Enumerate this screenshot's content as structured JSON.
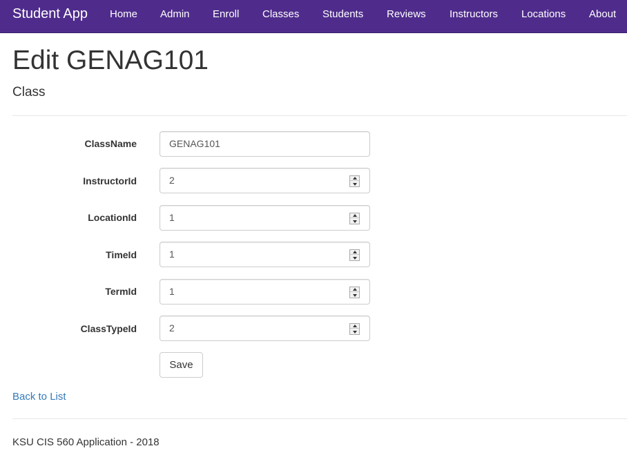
{
  "navbar": {
    "brand": "Student App",
    "links": [
      "Home",
      "Admin",
      "Enroll",
      "Classes",
      "Students",
      "Reviews",
      "Instructors",
      "Locations",
      "About"
    ]
  },
  "page": {
    "title": "Edit GENAG101",
    "subtitle": "Class"
  },
  "form": {
    "fields": [
      {
        "label": "ClassName",
        "value": "GENAG101",
        "type": "text"
      },
      {
        "label": "InstructorId",
        "value": "2",
        "type": "number"
      },
      {
        "label": "LocationId",
        "value": "1",
        "type": "number"
      },
      {
        "label": "TimeId",
        "value": "1",
        "type": "number"
      },
      {
        "label": "TermId",
        "value": "1",
        "type": "number"
      },
      {
        "label": "ClassTypeId",
        "value": "2",
        "type": "number"
      }
    ],
    "save_label": "Save"
  },
  "back_link": "Back to List",
  "footer": "KSU CIS 560 Application - 2018",
  "colors": {
    "navbar_bg": "#4f2c8c",
    "link": "#337ab7"
  }
}
